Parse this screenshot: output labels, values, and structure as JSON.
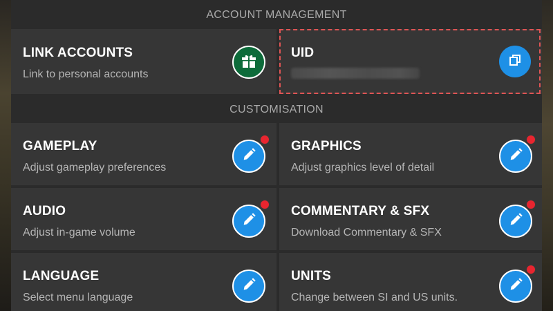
{
  "sections": {
    "account_management": "ACCOUNT MANAGEMENT",
    "customisation": "CUSTOMISATION"
  },
  "link_accounts": {
    "title": "LINK ACCOUNTS",
    "subtitle": "Link to personal accounts",
    "icon": "gift-icon"
  },
  "uid": {
    "title": "UID",
    "value_redacted": true,
    "icon": "copy-icon"
  },
  "settings": [
    {
      "title": "GAMEPLAY",
      "subtitle": "Adjust gameplay preferences",
      "icon": "pencil-icon",
      "notification_dot": true
    },
    {
      "title": "GRAPHICS",
      "subtitle": "Adjust graphics level of detail",
      "icon": "pencil-icon",
      "notification_dot": true
    },
    {
      "title": "AUDIO",
      "subtitle": "Adjust in-game volume",
      "icon": "pencil-icon",
      "notification_dot": true
    },
    {
      "title": "COMMENTARY & SFX",
      "subtitle": "Download Commentary & SFX",
      "icon": "pencil-icon",
      "notification_dot": true
    },
    {
      "title": "LANGUAGE",
      "subtitle": "Select menu language",
      "icon": "pencil-icon",
      "notification_dot": false
    },
    {
      "title": "UNITS",
      "subtitle": "Change between SI and US units.",
      "icon": "pencil-icon",
      "notification_dot": true
    }
  ],
  "colors": {
    "panel_bg": "#2b2b2b",
    "card_bg": "#363636",
    "accent_blue": "#1e90e6",
    "gift_green": "#0d6b3a",
    "notification_red": "#e8252f",
    "highlight_dashed": "#e05555"
  }
}
